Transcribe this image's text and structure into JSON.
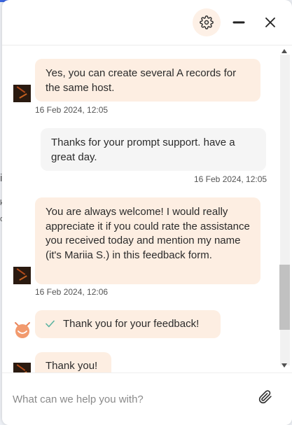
{
  "background": {
    "edge_chars": [
      "i",
      "k",
      "o"
    ]
  },
  "header": {
    "settings_icon": "gear-icon",
    "minimize_icon": "minus-icon",
    "close_icon": "close-icon"
  },
  "messages": [
    {
      "sender": "agent",
      "text": "Yes, you can create several A records for the same host.",
      "time": "16 Feb 2024, 12:05"
    },
    {
      "sender": "user",
      "text": "Thanks for your prompt support. have a great day.",
      "time": "16 Feb 2024, 12:05"
    },
    {
      "sender": "agent",
      "text": "You are always welcome! I would really appreciate it if you could rate the assistance you received today and mention my name (it's Mariia S.) in this feedback form.",
      "time": "16 Feb 2024, 12:06"
    },
    {
      "sender": "bot",
      "text": "Thank you for your feedback!",
      "icon": "check-icon"
    },
    {
      "sender": "agent",
      "text": "Thank you!"
    }
  ],
  "composer": {
    "placeholder": "What can we help you with?",
    "value": "",
    "attach_icon": "paperclip-icon"
  },
  "colors": {
    "agent_bubble": "#fdeee2",
    "user_bubble": "#f5f5f5",
    "accent": "#e8845a",
    "check": "#5bb3a0"
  }
}
